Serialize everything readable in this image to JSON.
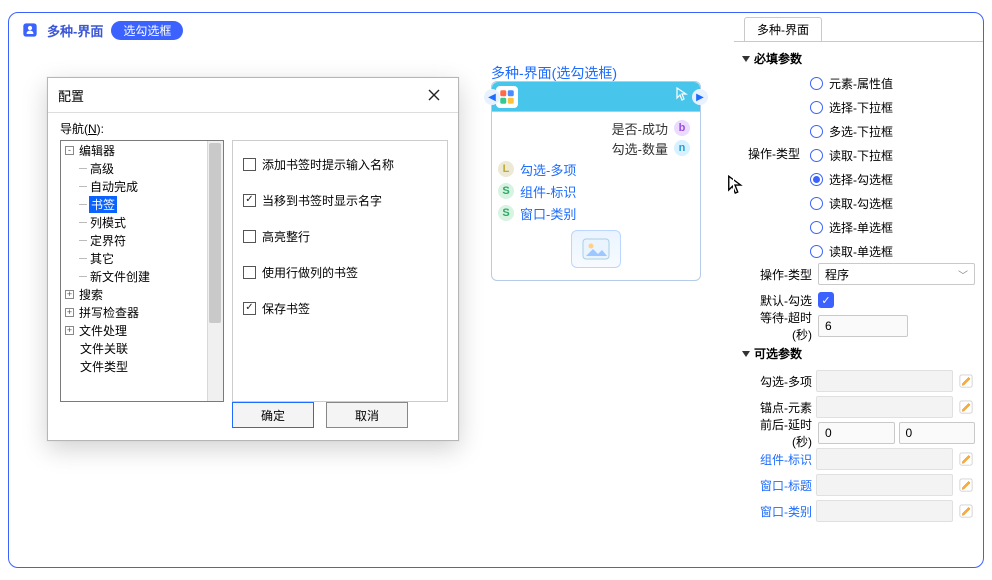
{
  "canvas": {
    "title": "多种-界面",
    "pill": "选勾选框"
  },
  "dialog": {
    "title": "配置",
    "nav_label_prefix": "导航(",
    "nav_label_key": "N",
    "nav_label_suffix": "):",
    "tree": [
      {
        "kind": "expand",
        "box": "-",
        "label": "编辑器"
      },
      {
        "kind": "child",
        "label": "高级"
      },
      {
        "kind": "child",
        "label": "自动完成"
      },
      {
        "kind": "child",
        "label": "书签",
        "selected": true
      },
      {
        "kind": "child",
        "label": "列模式"
      },
      {
        "kind": "child",
        "label": "定界符"
      },
      {
        "kind": "child",
        "label": "其它"
      },
      {
        "kind": "child",
        "label": "新文件创建"
      },
      {
        "kind": "expand",
        "box": "+",
        "label": "搜索"
      },
      {
        "kind": "expand",
        "box": "+",
        "label": "拼写检查器"
      },
      {
        "kind": "expand",
        "box": "+",
        "label": "文件处理"
      },
      {
        "kind": "plain",
        "label": "文件关联"
      },
      {
        "kind": "plain",
        "label": "文件类型"
      }
    ],
    "options": [
      {
        "label": "添加书签时提示输入名称",
        "checked": false
      },
      {
        "label": "当移到书签时显示名字",
        "checked": true
      },
      {
        "label": "高亮整行",
        "checked": false
      },
      {
        "label": "使用行做列的书签",
        "checked": false
      },
      {
        "label": "保存书签",
        "checked": true
      }
    ],
    "ok": "确定",
    "cancel": "取消"
  },
  "node": {
    "title": "多种-界面(选勾选框)",
    "out1": "是否-成功",
    "out2": "勾选-数量",
    "in1": "勾选-多项",
    "in2": "组件-标识",
    "in3": "窗口-类别"
  },
  "side": {
    "tab": "多种-界面",
    "required": "必填参数",
    "optional": "可选参数",
    "radio_group_label": "操作-类型",
    "radios": [
      {
        "label": "元素-属性值",
        "checked": false
      },
      {
        "label": "选择-下拉框",
        "checked": false
      },
      {
        "label": "多选-下拉框",
        "checked": false
      },
      {
        "label": "读取-下拉框",
        "checked": false
      },
      {
        "label": "选择-勾选框",
        "checked": true
      },
      {
        "label": "读取-勾选框",
        "checked": false
      },
      {
        "label": "选择-单选框",
        "checked": false
      },
      {
        "label": "读取-单选框",
        "checked": false
      }
    ],
    "op_type_label": "操作-类型",
    "op_type_value": "程序",
    "default_check_label": "默认-勾选",
    "default_check": true,
    "timeout_label": "等待-超时(秒)",
    "timeout_value": "6",
    "opt_fields": {
      "check_many": "勾选-多项",
      "anchor_elem": "锚点-元素",
      "delay_label": "前后-延时(秒)",
      "delay_a": "0",
      "delay_b": "0",
      "comp_id": "组件-标识",
      "win_title": "窗口-标题",
      "win_class": "窗口-类别"
    }
  }
}
